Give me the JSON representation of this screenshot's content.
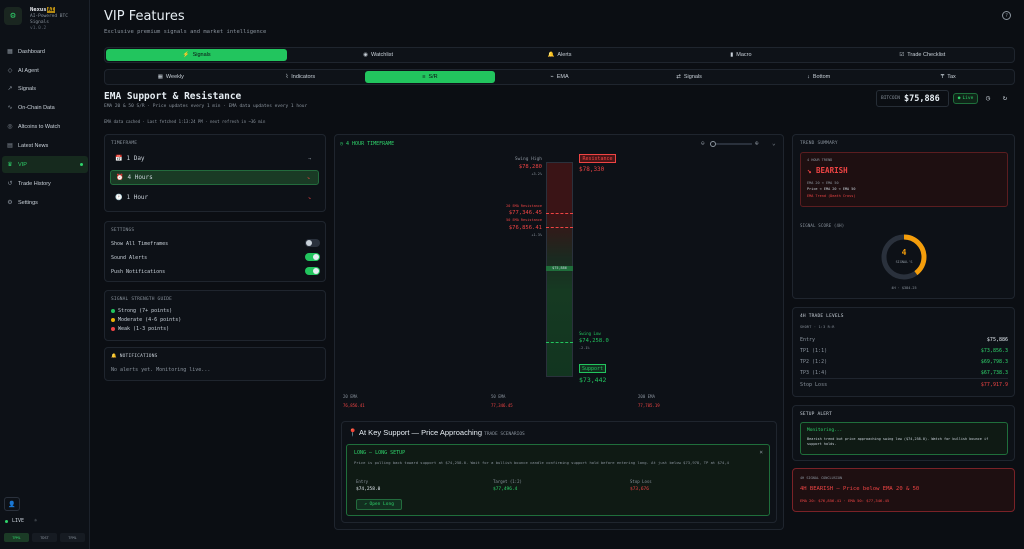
{
  "brand": {
    "name_pre": "Nexus",
    "name_hl": "AI",
    "tag": "AI-Powered BTC",
    "line2": "Signals",
    "version": "v1.0.2"
  },
  "sidebar": {
    "items": [
      {
        "label": "Dashboard",
        "icon": "grid-icon"
      },
      {
        "label": "AI Agent",
        "icon": "bot-icon"
      },
      {
        "label": "Signals",
        "icon": "signal-icon"
      },
      {
        "label": "On-Chain Data",
        "icon": "chain-icon"
      },
      {
        "label": "Altcoins to Watch",
        "icon": "coin-icon"
      },
      {
        "label": "Latest News",
        "icon": "news-icon"
      },
      {
        "label": "VIP",
        "icon": "crown-icon"
      },
      {
        "label": "Trade History",
        "icon": "history-icon"
      },
      {
        "label": "Settings",
        "icon": "gear-icon"
      }
    ],
    "live": "LIVE",
    "modes": [
      "TPML",
      "TDST",
      "TFML"
    ]
  },
  "header": {
    "title": "VIP Features",
    "subtitle": "Exclusive premium signals and market intelligence"
  },
  "tabs": [
    "Signals",
    "Watchlist",
    "Alerts",
    "Macro",
    "Trade Checklist"
  ],
  "subtabs": [
    "Weekly",
    "Indicators",
    "S/R",
    "EMA",
    "Signals",
    "Bottom",
    "Tax"
  ],
  "section": {
    "title": "EMA Support & Resistance",
    "sub": "EMA 20 & 50 S/R · Price updates every 1 min · EMA data updates every 1 hour",
    "cache": "EMA data cached · Last fetched 1:13:24 PM · next refresh in ~36 min",
    "price_label": "BITCOIN",
    "price": "$75,886",
    "live": "Live"
  },
  "timeframe": {
    "label": "TIMEFRAME",
    "items": [
      {
        "label": "1 Day",
        "arrow": "→",
        "icon": "calendar-icon"
      },
      {
        "label": "4 Hours",
        "arrow": "↘",
        "icon": "clock-icon"
      },
      {
        "label": "1 Hour",
        "arrow": "↘",
        "icon": "clock-icon"
      }
    ]
  },
  "settings": {
    "label": "SETTINGS",
    "rows": [
      {
        "label": "Show All Timeframes",
        "on": false
      },
      {
        "label": "Sound Alerts",
        "on": true
      },
      {
        "label": "Push Notifications",
        "on": true
      }
    ]
  },
  "strength": {
    "label": "SIGNAL STRENGTH GUIDE",
    "items": [
      {
        "label": "Strong (7+ points)",
        "color": "#22c55e"
      },
      {
        "label": "Moderate (4-6 points)",
        "color": "#eab308"
      },
      {
        "label": "Weak (1-3 points)",
        "color": "#ef4444"
      }
    ]
  },
  "notifications": {
    "label": "NOTIFICATIONS",
    "text": "No alerts yet. Monitoring live..."
  },
  "chart": {
    "label": "4 HOUR TIMEFRAME",
    "top": {
      "name": "Swing High",
      "value": "$78,280",
      "pct": "+3.2%"
    },
    "resistance": {
      "tag": "Resistance",
      "value": "$78,330"
    },
    "ema20": {
      "name": "20 EMA Resistance",
      "value": "$77,346.45",
      "pct": "+1.9%"
    },
    "ema50": {
      "name": "50 EMA Resistance",
      "value": "$76,856.41",
      "pct": "+1.3%"
    },
    "now": "$75,886",
    "swing": {
      "name": "Swing Low",
      "value": "$74,258.0",
      "pct": "-2.1%"
    },
    "support": {
      "tag": "Support",
      "value": "$73,442"
    },
    "foot": [
      {
        "name": "20 EMA",
        "value": "76,856.41"
      },
      {
        "name": "50 EMA",
        "value": "77,346.45"
      },
      {
        "name": "200 EMA",
        "value": "77,785.19"
      }
    ]
  },
  "scenario": {
    "title": "At Key Support — Price Approaching",
    "tag": "TRADE SCENARIOS",
    "setup": "LONG — LONG SETUP",
    "desc": "Price is pulling back toward support at $74,258.0. Wait for a bullish bounce candle confirming support hold before entering long. At just below $73,978, TP at $74,4",
    "entry_label": "Entry",
    "entry": "$74,258.0",
    "target_label": "Target (1:2)",
    "target": "$77,496.4",
    "stop_label": "Stop Loss",
    "stop": "$73,676",
    "button": "Open Long"
  },
  "trend": {
    "label": "TREND SUMMARY",
    "sub": "4 HOUR TREND",
    "value": "BEARISH",
    "l1": "EMA 20 < EMA 50",
    "l2": "Price < EMA 20 < EMA 50",
    "l3": "EMA Trend (Death Cross)",
    "score_label": "SIGNAL SCORE (4H)",
    "score": "4",
    "score_text": "SIGNAL'S",
    "foot": "4H · $384.25"
  },
  "levels": {
    "label": "4H TRADE LEVELS",
    "sub": "SHORT · 1:3 R:R",
    "rows": [
      {
        "k": "Entry",
        "v": "$75,886"
      },
      {
        "k": "TP1 (1:1)",
        "v": "$73,856.3"
      },
      {
        "k": "TP2 (1:2)",
        "v": "$69,798.3"
      },
      {
        "k": "TP3 (1:4)",
        "v": "$67,738.3"
      },
      {
        "k": "Stop Loss",
        "v": "$77,917.9"
      }
    ]
  },
  "alert": {
    "label": "SETUP ALERT",
    "status": "Monitoring...",
    "text": "Bearish trend but price approaching swing low ($74,258.0). Watch for bullish bounce if support holds."
  },
  "conclusion": {
    "label": "4H SIGNAL CONCLUSION",
    "value": "4H BEARISH — Price below EMA 20 & 50",
    "foot": "EMA 20: $76,856.41 · EMA 50: $77,346.45"
  }
}
